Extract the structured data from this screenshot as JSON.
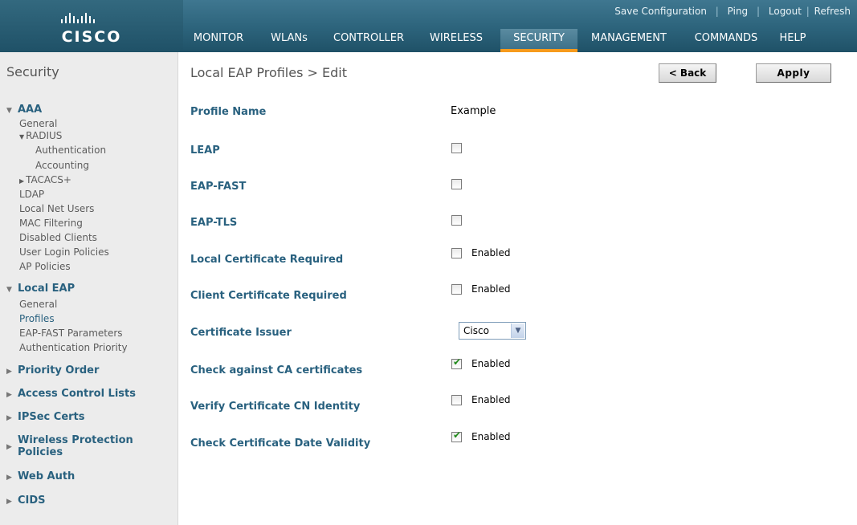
{
  "brand": {
    "logo_text": "CISCO"
  },
  "top_links": {
    "save": "Save Configuration",
    "ping": "Ping",
    "logout": "Logout",
    "refresh": "Refresh"
  },
  "menu": [
    "MONITOR",
    "WLANs",
    "CONTROLLER",
    "WIRELESS",
    "SECURITY",
    "MANAGEMENT",
    "COMMANDS",
    "HELP"
  ],
  "menu_active": "SECURITY",
  "sidebar": {
    "title": "Security",
    "aaa": {
      "label": "AAA",
      "general": "General",
      "radius": "RADIUS",
      "authentication": "Authentication",
      "accounting": "Accounting",
      "tacacs": "TACACS+",
      "ldap": "LDAP",
      "local_net_users": "Local Net Users",
      "mac_filtering": "MAC Filtering",
      "disabled_clients": "Disabled Clients",
      "user_login_policies": "User Login Policies",
      "ap_policies": "AP Policies"
    },
    "local_eap": {
      "label": "Local EAP",
      "general": "General",
      "profiles": "Profiles",
      "eap_fast_parameters": "EAP-FAST Parameters",
      "authentication_priority": "Authentication Priority"
    },
    "priority_order": "Priority Order",
    "access_control_lists": "Access Control Lists",
    "ipsec_certs": "IPSec Certs",
    "wireless_protection_1": "Wireless Protection",
    "wireless_protection_2": "Policies",
    "web_auth": "Web Auth",
    "cids": "CIDS"
  },
  "page": {
    "title": "Local EAP Profiles > Edit",
    "back_label": "< Back",
    "apply_label": "Apply"
  },
  "form": {
    "profile_name": {
      "label": "Profile Name",
      "value": "Example"
    },
    "leap": {
      "label": "LEAP",
      "checked": false
    },
    "eap_fast": {
      "label": "EAP-FAST",
      "checked": false
    },
    "eap_tls": {
      "label": "EAP-TLS",
      "checked": false
    },
    "local_cert_required": {
      "label": "Local Certificate Required",
      "checked": false,
      "text": "Enabled"
    },
    "client_cert_required": {
      "label": "Client Certificate Required",
      "checked": false,
      "text": "Enabled"
    },
    "certificate_issuer": {
      "label": "Certificate Issuer",
      "value": "Cisco"
    },
    "check_ca": {
      "label": "Check against CA certificates",
      "checked": true,
      "text": "Enabled"
    },
    "verify_cn": {
      "label": "Verify Certificate CN Identity",
      "checked": false,
      "text": "Enabled"
    },
    "check_date": {
      "label": "Check Certificate Date Validity",
      "checked": true,
      "text": "Enabled"
    }
  }
}
